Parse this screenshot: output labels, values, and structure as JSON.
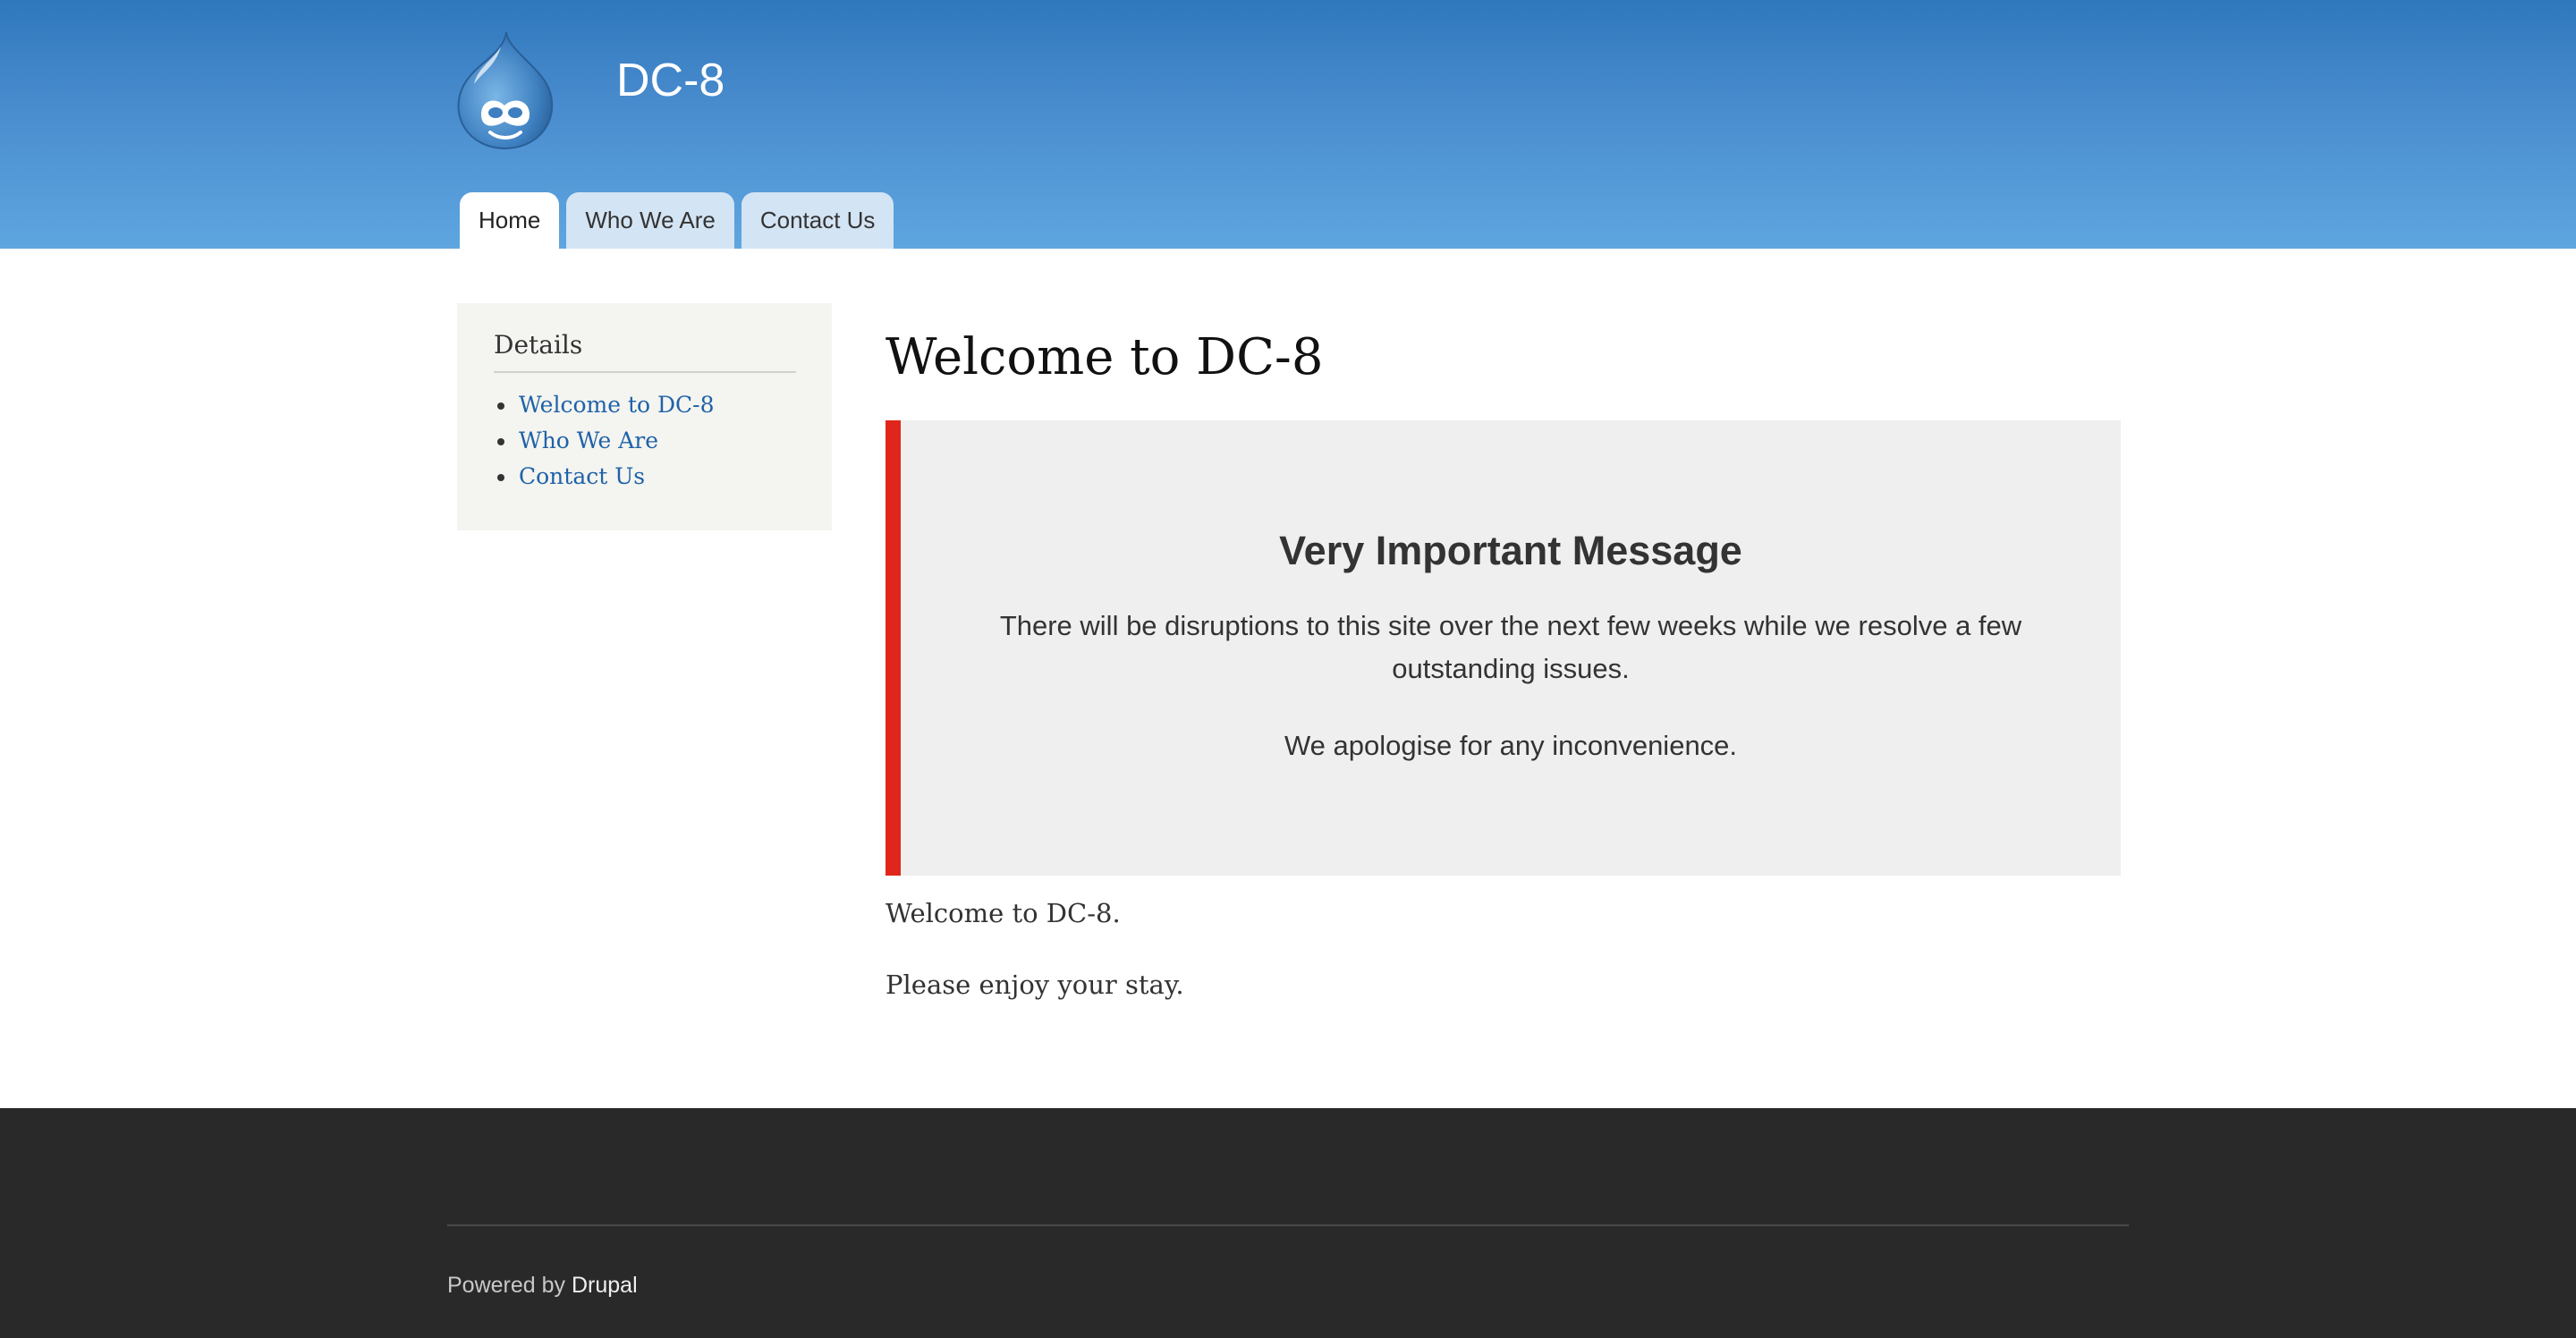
{
  "header": {
    "site_name": "DC-8",
    "logo_icon": "drupal-drop-logo-icon",
    "tabs": [
      {
        "label": "Home",
        "active": true
      },
      {
        "label": "Who We Are",
        "active": false
      },
      {
        "label": "Contact Us",
        "active": false
      }
    ]
  },
  "sidebar": {
    "title": "Details",
    "links": [
      {
        "label": "Welcome to DC-8"
      },
      {
        "label": "Who We Are"
      },
      {
        "label": "Contact Us"
      }
    ]
  },
  "main": {
    "title": "Welcome to DC-8",
    "notice": {
      "title": "Very Important Message",
      "text": "There will be disruptions to this site over the next few weeks while we resolve a few outstanding issues.",
      "text2": "We apologise for any inconvenience."
    },
    "paragraphs": [
      "Welcome to DC-8.",
      "Please enjoy your stay."
    ]
  },
  "footer": {
    "powered_prefix": "Powered by",
    "powered_link": "Drupal"
  },
  "colors": {
    "header_top": "#2f78bc",
    "header_bottom": "#5ea6e0",
    "notice_border": "#e0261c",
    "link": "#1f62a8",
    "footer_bg": "#292929"
  }
}
